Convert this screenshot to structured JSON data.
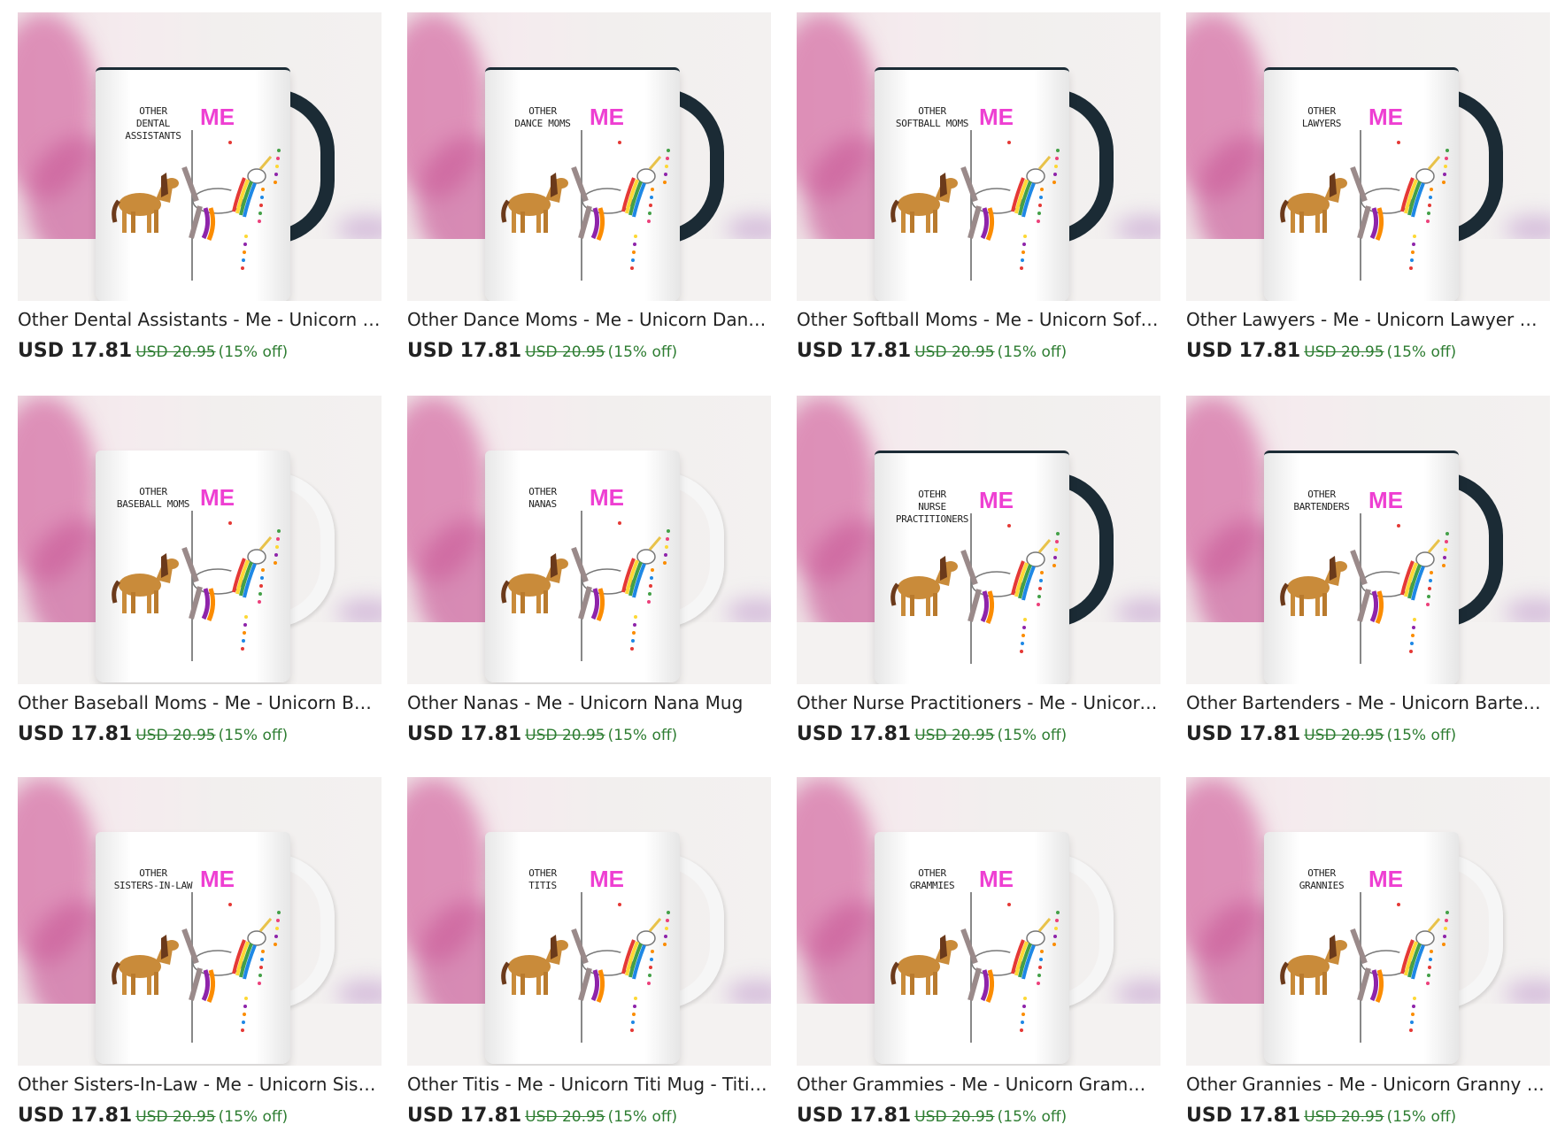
{
  "products": [
    {
      "title": "Other Dental Assistants - Me - Unicorn Dental Assistant Mug",
      "price": "USD 17.81",
      "original_price": "USD 20.95",
      "discount": "(15% off)",
      "art_line1": "Other",
      "art_line2": "Dental",
      "art_line3": "Assistants",
      "art_me": "ME",
      "handle": "black"
    },
    {
      "title": "Other Dance Moms - Me - Unicorn Dance Mom Mug",
      "price": "USD 17.81",
      "original_price": "USD 20.95",
      "discount": "(15% off)",
      "art_line1": "Other",
      "art_line2": "Dance Moms",
      "art_line3": "",
      "art_me": "ME",
      "handle": "black"
    },
    {
      "title": "Other Softball Moms - Me - Unicorn Softball Mom Mug",
      "price": "USD 17.81",
      "original_price": "USD 20.95",
      "discount": "(15% off)",
      "art_line1": "Other",
      "art_line2": "Softball Moms",
      "art_line3": "",
      "art_me": "ME",
      "handle": "black"
    },
    {
      "title": "Other Lawyers - Me - Unicorn Lawyer Mug",
      "price": "USD 17.81",
      "original_price": "USD 20.95",
      "discount": "(15% off)",
      "art_line1": "Other",
      "art_line2": "Lawyers",
      "art_line3": "",
      "art_me": "ME",
      "handle": "black"
    },
    {
      "title": "Other Baseball Moms - Me - Unicorn Baseball Mom Mug",
      "price": "USD 17.81",
      "original_price": "USD 20.95",
      "discount": "(15% off)",
      "art_line1": "Other",
      "art_line2": "Baseball Moms",
      "art_line3": "",
      "art_me": "ME",
      "handle": "white"
    },
    {
      "title": "Other Nanas - Me - Unicorn Nana Mug",
      "price": "USD 17.81",
      "original_price": "USD 20.95",
      "discount": "(15% off)",
      "art_line1": "Other",
      "art_line2": "Nanas",
      "art_line3": "",
      "art_me": "ME",
      "handle": "white"
    },
    {
      "title": "Other Nurse Practitioners - Me - Unicorn Nurse Practitioner Mug",
      "price": "USD 17.81",
      "original_price": "USD 20.95",
      "discount": "(15% off)",
      "art_line1": "Otehr",
      "art_line2": "Nurse",
      "art_line3": "Practitioners",
      "art_me": "ME",
      "handle": "black"
    },
    {
      "title": "Other Bartenders - Me - Unicorn Bartender Mug",
      "price": "USD 17.81",
      "original_price": "USD 20.95",
      "discount": "(15% off)",
      "art_line1": "Other",
      "art_line2": "Bartenders",
      "art_line3": "",
      "art_me": "ME",
      "handle": "black"
    },
    {
      "title": "Other Sisters-In-Law - Me - Unicorn Sister-In-Law Mug",
      "price": "USD 17.81",
      "original_price": "USD 20.95",
      "discount": "(15% off)",
      "art_line1": "Other",
      "art_line2": "Sisters-in-law",
      "art_line3": "",
      "art_me": "ME",
      "handle": "white"
    },
    {
      "title": "Other Titis - Me - Unicorn Titi Mug - Titi Gift",
      "price": "USD 17.81",
      "original_price": "USD 20.95",
      "discount": "(15% off)",
      "art_line1": "Other",
      "art_line2": "Titis",
      "art_line3": "",
      "art_me": "ME",
      "handle": "white"
    },
    {
      "title": "Other Grammies - Me - Unicorn Grammy Mug",
      "price": "USD 17.81",
      "original_price": "USD 20.95",
      "discount": "(15% off)",
      "art_line1": "Other",
      "art_line2": "Grammies",
      "art_line3": "",
      "art_me": "ME",
      "handle": "white"
    },
    {
      "title": "Other Grannies - Me - Unicorn Granny Mug",
      "price": "USD 17.81",
      "original_price": "USD 20.95",
      "discount": "(15% off)",
      "art_line1": "Other",
      "art_line2": "Grannies",
      "art_line3": "",
      "art_me": "ME",
      "handle": "white"
    }
  ],
  "colors": {
    "price_text": "#222222",
    "discount_green": "#2e7d32",
    "me_pink": "#ee3fd2",
    "handle_black": "#1b2b35"
  }
}
